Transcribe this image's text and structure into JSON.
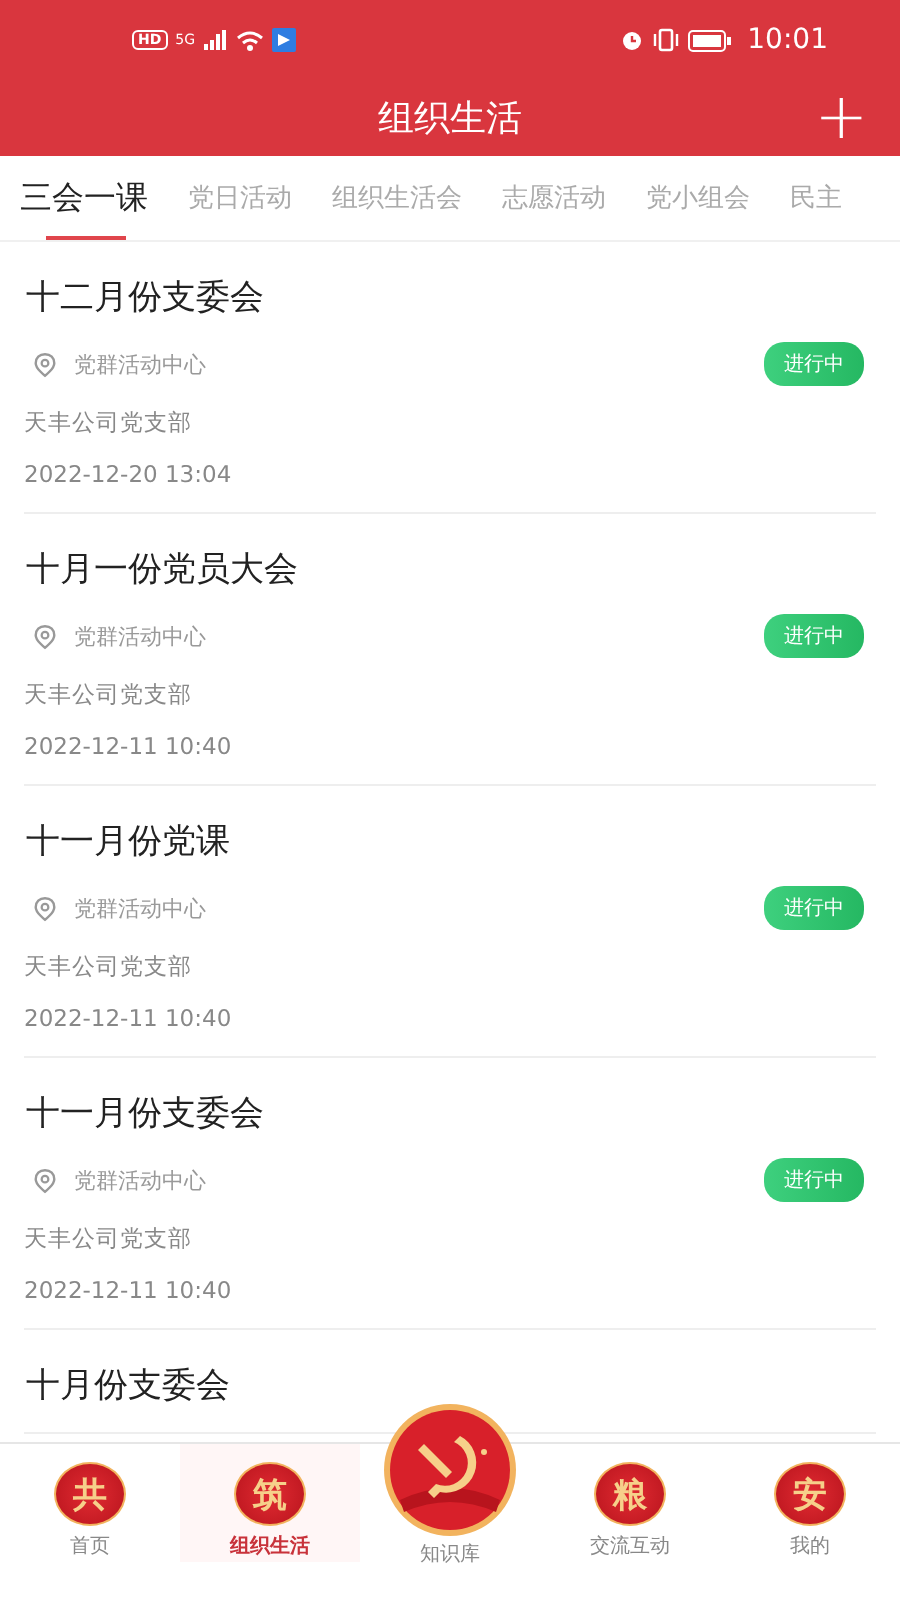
{
  "status_bar": {
    "badge": "HD",
    "network": "5G",
    "time": "10:01"
  },
  "header": {
    "title": "组织生活",
    "add_symbol": "+"
  },
  "tabs": [
    {
      "label": "三会一课",
      "selected": true
    },
    {
      "label": "党日活动",
      "selected": false
    },
    {
      "label": "组织生活会",
      "selected": false
    },
    {
      "label": "志愿活动",
      "selected": false
    },
    {
      "label": "党小组会",
      "selected": false
    },
    {
      "label": "民主",
      "selected": false
    }
  ],
  "meetings": [
    {
      "title": "十二月份支委会",
      "location": "党群活动中心",
      "status": "进行中",
      "branch": "天丰公司党支部",
      "time": "2022-12-20 13:04"
    },
    {
      "title": "十月一份党员大会",
      "location": "党群活动中心",
      "status": "进行中",
      "branch": "天丰公司党支部",
      "time": "2022-12-11 10:40"
    },
    {
      "title": "十一月份党课",
      "location": "党群活动中心",
      "status": "进行中",
      "branch": "天丰公司党支部",
      "time": "2022-12-11 10:40"
    },
    {
      "title": "十一月份支委会",
      "location": "党群活动中心",
      "status": "进行中",
      "branch": "天丰公司党支部",
      "time": "2022-12-11 10:40"
    },
    {
      "title": "十月份支委会"
    }
  ],
  "bottom_nav": [
    {
      "glyph": "共",
      "label": "首页",
      "selected": false,
      "kind": "badge"
    },
    {
      "glyph": "筑",
      "label": "组织生活",
      "selected": true,
      "kind": "badge"
    },
    {
      "label": "知识库",
      "selected": false,
      "kind": "emblem"
    },
    {
      "glyph": "粮",
      "label": "交流互动",
      "selected": false,
      "kind": "badge"
    },
    {
      "glyph": "安",
      "label": "我的",
      "selected": false,
      "kind": "badge"
    }
  ]
}
